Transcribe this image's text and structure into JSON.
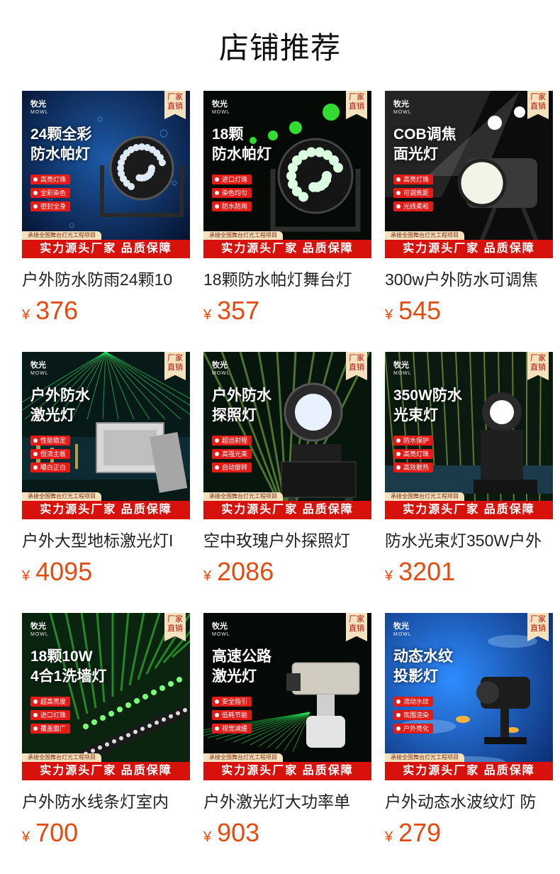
{
  "header": {
    "title": "店铺推荐"
  },
  "currency": "¥",
  "colors": {
    "price": "#e64a0e",
    "banner_red": "#d7120d",
    "badge_cream": "#f4e1bd"
  },
  "products": [
    {
      "brand": "牧光",
      "brand_sub": "MOWL",
      "badge": "厂家\n直销",
      "headline": "24颗全彩\n防水帕灯",
      "features": [
        "高亮灯珠",
        "全彩染色",
        "密封全身"
      ],
      "strip": "承接全国舞台灯光工程项目",
      "banner": "实力源头厂家 品质保障",
      "name": "户外防水防雨24颗10",
      "price": "376",
      "scene": "water"
    },
    {
      "brand": "牧光",
      "brand_sub": "MOWL",
      "badge": "厂家\n直销",
      "headline": "18颗\n防水帕灯",
      "features": [
        "进口灯珠",
        "染色均匀",
        "防水防雨"
      ],
      "strip": "承接全国舞台灯光工程项目",
      "banner": "实力源头厂家 品质保障",
      "name": "18颗防水帕灯舞台灯",
      "price": "357",
      "scene": "green"
    },
    {
      "brand": "牧光",
      "brand_sub": "MOWL",
      "badge": "厂家\n直销",
      "headline": "COB调焦\n面光灯",
      "features": [
        "高亮灯珠",
        "可调焦距",
        "光线柔和"
      ],
      "strip": "承接全国舞台灯光工程项目",
      "banner": "实力源头厂家 品质保障",
      "name": "300w户外防水可调焦",
      "price": "545",
      "scene": "spot"
    },
    {
      "brand": "牧光",
      "brand_sub": "MOWL",
      "badge": "厂家\n直销",
      "headline": "户外防水\n激光灯",
      "features": [
        "性能稳定",
        "恒流主板",
        "曝白正白"
      ],
      "strip": "承接全国舞台灯光工程项目",
      "banner": "实力源头厂家 品质保障",
      "name": "户外大型地标激光灯I",
      "price": "4095",
      "scene": "laser"
    },
    {
      "brand": "牧光",
      "brand_sub": "MOWL",
      "badge": "厂家\n直销",
      "headline": "户外防水\n探照灯",
      "features": [
        "超远射程",
        "高强光束",
        "自动旋转"
      ],
      "strip": "承接全国舞台灯光工程项目",
      "banner": "实力源头厂家 品质保障",
      "name": "空中玫瑰户外探照灯",
      "price": "2086",
      "scene": "search"
    },
    {
      "brand": "牧光",
      "brand_sub": "MOWL",
      "badge": "厂家\n直销",
      "headline": "350W防水\n光束灯",
      "features": [
        "防水保护",
        "高亮灯珠",
        "高效散热"
      ],
      "strip": "承接全国舞台灯光工程项目",
      "banner": "实力源头厂家 品质保障",
      "name": "防水光束灯350W户外",
      "price": "3201",
      "scene": "beam"
    },
    {
      "brand": "牧光",
      "brand_sub": "MOWL",
      "badge": "厂家\n直销",
      "headline": "18颗10W\n4合1洗墙灯",
      "features": [
        "超高亮度",
        "进口灯珠",
        "覆盖面广"
      ],
      "strip": "承接全国舞台灯光工程项目",
      "banner": "实力源头厂家 品质保障",
      "name": "户外防水线条灯室内",
      "price": "700",
      "scene": "wall"
    },
    {
      "brand": "牧光",
      "brand_sub": "MOWL",
      "badge": "厂家\n直销",
      "headline": "高速公路\n激光灯",
      "features": [
        "安全指引",
        "低耗节能",
        "视觉减缓"
      ],
      "strip": "承接全国舞台灯光工程项目",
      "banner": "实力源头厂家 品质保障",
      "name": "户外激光灯大功率单",
      "price": "903",
      "scene": "road"
    },
    {
      "brand": "牧光",
      "brand_sub": "MOWL",
      "badge": "厂家\n直销",
      "headline": "动态水纹\n投影灯",
      "features": [
        "流动水纹",
        "氛围渲染",
        "户外亮化"
      ],
      "strip": "承接全国舞台灯光工程项目",
      "banner": "实力源头厂家 品质保障",
      "name": "户外动态水波纹灯 防",
      "price": "279",
      "scene": "ripple"
    }
  ]
}
